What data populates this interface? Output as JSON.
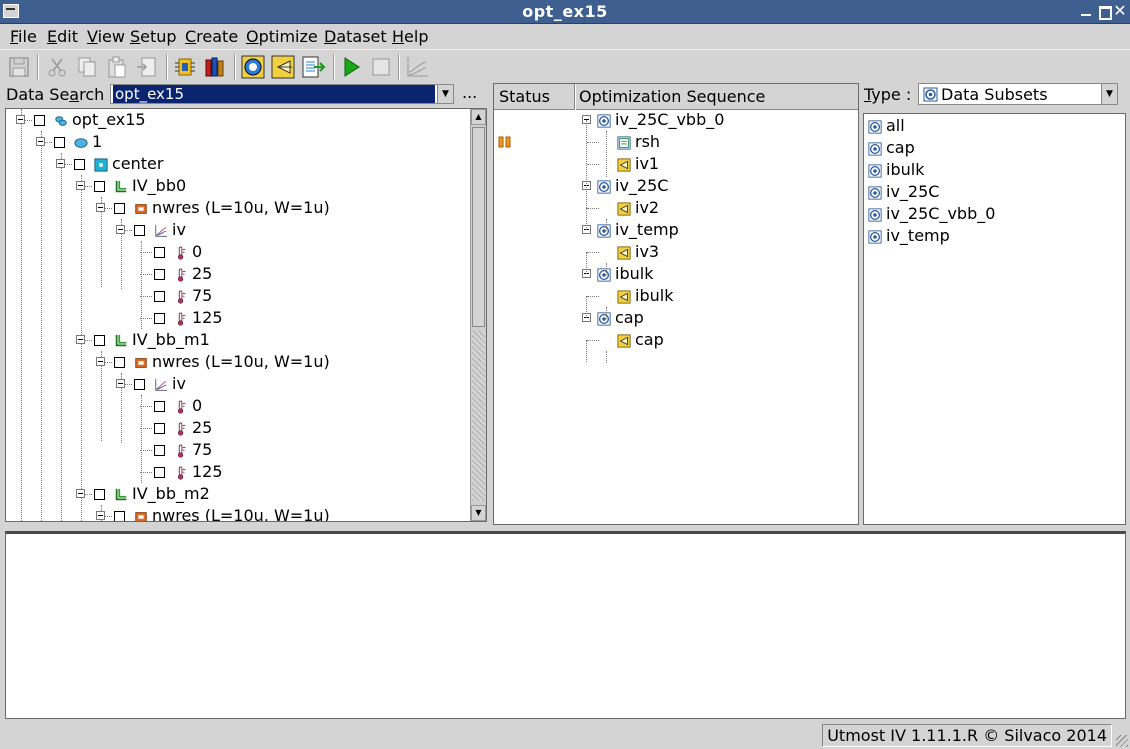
{
  "window": {
    "title": "opt_ex15"
  },
  "menu": [
    {
      "label": "File",
      "u": "F",
      "rest": "ile"
    },
    {
      "label": "Edit",
      "u": "E",
      "rest": "dit"
    },
    {
      "label": "View",
      "u": "V",
      "rest": "iew"
    },
    {
      "label": "Setup",
      "u": "S",
      "rest": "etup"
    },
    {
      "label": "Create",
      "u": "C",
      "rest": "reate"
    },
    {
      "label": "Optimize",
      "u": "O",
      "rest": "ptimize"
    },
    {
      "label": "Dataset",
      "u": "D",
      "rest": "ataset"
    },
    {
      "label": "Help",
      "u": "H",
      "rest": "elp"
    }
  ],
  "toolbar": {
    "icons": [
      "save-icon",
      "cut-icon",
      "copy-icon",
      "paste-icon",
      "import-icon",
      "device-icon",
      "library-icon",
      "target-icon",
      "simulate-icon",
      "export-icon",
      "run-icon",
      "stop-icon",
      "plot-icon"
    ]
  },
  "search": {
    "label": "Data Search :",
    "value": "opt_ex15",
    "more": "..."
  },
  "tree": [
    {
      "text": "opt_ex15",
      "level": 0,
      "icon": "project-icon"
    },
    {
      "text": "1",
      "level": 1,
      "icon": "wafer-icon"
    },
    {
      "text": "center",
      "level": 2,
      "icon": "die-icon"
    },
    {
      "text": "IV_bb0",
      "level": 3,
      "icon": "setup-icon"
    },
    {
      "text": "nwres (L=10u, W=1u)",
      "level": 4,
      "icon": "resistor-icon"
    },
    {
      "text": "iv",
      "level": 5,
      "icon": "curve-icon"
    },
    {
      "text": "0",
      "level": 6,
      "icon": "temperature-icon"
    },
    {
      "text": "25",
      "level": 6,
      "icon": "temperature-icon"
    },
    {
      "text": "75",
      "level": 6,
      "icon": "temperature-icon"
    },
    {
      "text": "125",
      "level": 6,
      "icon": "temperature-icon"
    },
    {
      "text": "IV_bb_m1",
      "level": 3,
      "icon": "setup-icon"
    },
    {
      "text": "nwres (L=10u, W=1u)",
      "level": 4,
      "icon": "resistor-icon"
    },
    {
      "text": "iv",
      "level": 5,
      "icon": "curve-icon"
    },
    {
      "text": "0",
      "level": 6,
      "icon": "temperature-icon"
    },
    {
      "text": "25",
      "level": 6,
      "icon": "temperature-icon"
    },
    {
      "text": "75",
      "level": 6,
      "icon": "temperature-icon"
    },
    {
      "text": "125",
      "level": 6,
      "icon": "temperature-icon"
    },
    {
      "text": "IV_bb_m2",
      "level": 3,
      "icon": "setup-icon"
    },
    {
      "text": "nwres (L=10u, W=1u)",
      "level": 4,
      "icon": "resistor-icon"
    }
  ],
  "sequence": {
    "col_status": "Status",
    "col_sequence": "Optimization Sequence",
    "items": [
      {
        "text": "iv_25C_vbb_0",
        "level": 0,
        "icon": "subset-icon",
        "status": ""
      },
      {
        "text": "rsh",
        "level": 1,
        "icon": "parameter-icon",
        "status": "paused"
      },
      {
        "text": "iv1",
        "level": 1,
        "icon": "target-curve-icon",
        "status": ""
      },
      {
        "text": "iv_25C",
        "level": 0,
        "icon": "subset-icon",
        "status": ""
      },
      {
        "text": "iv2",
        "level": 1,
        "icon": "target-curve-icon",
        "status": ""
      },
      {
        "text": "iv_temp",
        "level": 0,
        "icon": "subset-icon",
        "status": ""
      },
      {
        "text": "iv3",
        "level": 1,
        "icon": "target-curve-icon",
        "status": ""
      },
      {
        "text": "ibulk",
        "level": 0,
        "icon": "subset-icon",
        "status": ""
      },
      {
        "text": "ibulk",
        "level": 1,
        "icon": "target-curve-icon",
        "status": ""
      },
      {
        "text": "cap",
        "level": 0,
        "icon": "subset-icon",
        "status": ""
      },
      {
        "text": "cap",
        "level": 1,
        "icon": "target-curve-icon",
        "status": ""
      }
    ]
  },
  "type_selector": {
    "label": "Type :",
    "value": "Data Subsets"
  },
  "subsets": [
    "all",
    "cap",
    "ibulk",
    "iv_25C",
    "iv_25C_vbb_0",
    "iv_temp"
  ],
  "status_bar": {
    "text": "Utmost IV 1.11.1.R © Silvaco 2014"
  }
}
